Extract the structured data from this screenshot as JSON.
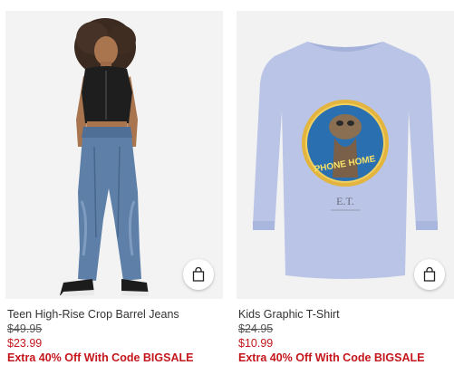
{
  "products": [
    {
      "name": "Teen High-Rise Crop Barrel Jeans",
      "original_price": "$49.95",
      "sale_price": "$23.99",
      "promo": "Extra 40% Off With Code BIGSALE",
      "image_icon": "model-photo"
    },
    {
      "name": "Kids Graphic T-Shirt",
      "original_price": "$24.95",
      "sale_price": "$10.99",
      "promo": "Extra 40% Off With Code BIGSALE",
      "image_icon": "et-graphic-shirt-photo",
      "graphic_text": "PHONE HOME",
      "graphic_caption": "E.T."
    }
  ],
  "colors": {
    "sale_red": "#c4161c",
    "image_bg": "#f2f2f2",
    "shirt": "#b9c4e6"
  }
}
